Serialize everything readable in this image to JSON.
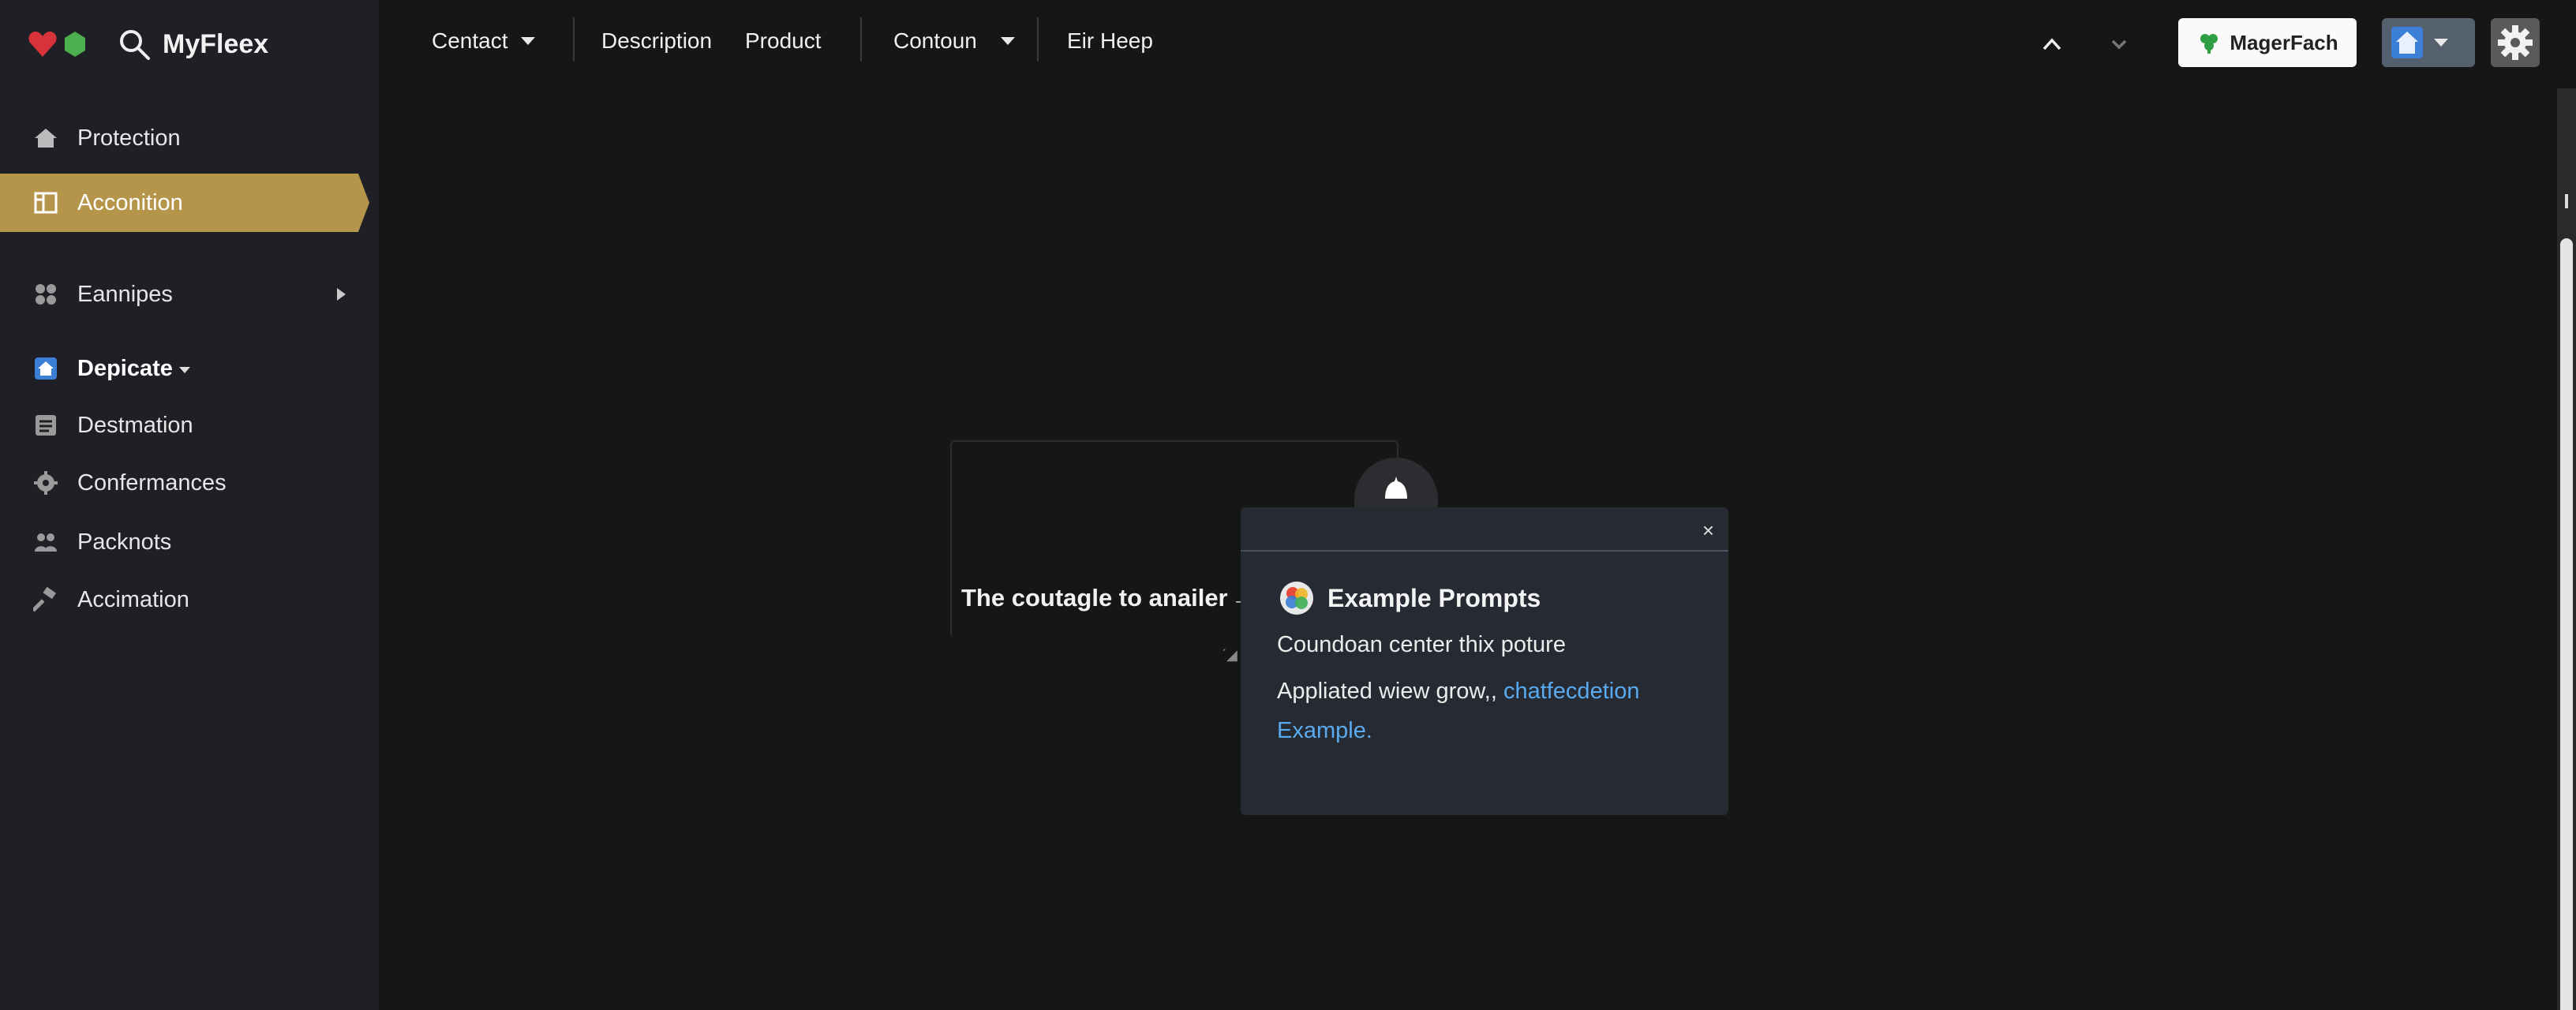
{
  "brand": {
    "title": "MyFleex"
  },
  "sidebar": {
    "items": [
      {
        "label": "Protection",
        "icon": "home-icon"
      },
      {
        "label": "Acconition",
        "icon": "panel-icon",
        "active": true
      },
      {
        "label": "Eannipes",
        "icon": "puzzle-icon",
        "expandable": true
      },
      {
        "label": "Depicate",
        "icon": "house-blue-icon"
      },
      {
        "label": "Destmation",
        "icon": "list-icon"
      },
      {
        "label": "Confermances",
        "icon": "gear-icon"
      },
      {
        "label": "Packnots",
        "icon": "people-icon"
      },
      {
        "label": "Accimation",
        "icon": "hammer-icon"
      }
    ]
  },
  "topnav": {
    "items": [
      "Centact",
      "Description",
      "Product",
      "Contoun",
      "Eir Heep"
    ]
  },
  "toolbar": {
    "primary_button": "MagerFach"
  },
  "canvas": {
    "caption": "The coutagle to anailer",
    "arrow": "→",
    "mark": "ˊ◢"
  },
  "popup": {
    "title": "Example Prompts",
    "close": "×",
    "line1": "Coundoan center thix poture",
    "line2_text": "Appliated wiew grow,, ",
    "line2_link": "chatfecdetion Example."
  },
  "colors": {
    "active_bg": "#b4954a",
    "link": "#5aaaf0",
    "sidebar_bg": "#1e2026",
    "popup_bg": "#252a33"
  }
}
